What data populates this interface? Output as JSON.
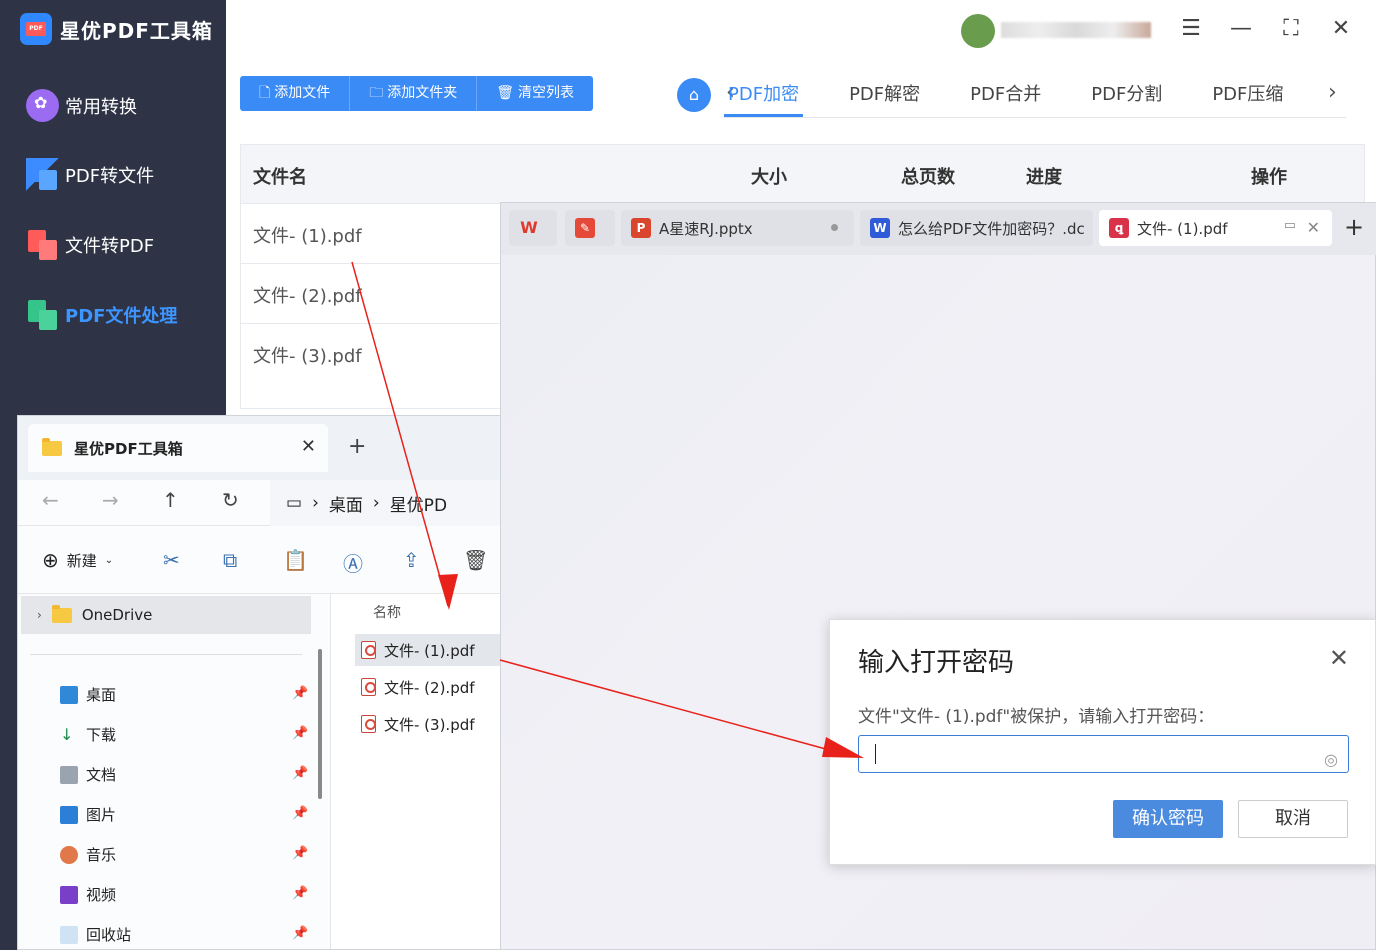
{
  "app": {
    "title": "星优PDF工具箱",
    "sidebar": [
      {
        "label": "常用转换",
        "icon": "common-convert-icon"
      },
      {
        "label": "PDF转文件",
        "icon": "pdf-to-file-icon"
      },
      {
        "label": "文件转PDF",
        "icon": "file-to-pdf-icon"
      },
      {
        "label": "PDF文件处理",
        "icon": "pdf-process-icon",
        "active": true
      }
    ],
    "toolbar": {
      "add_file": "添加文件",
      "add_folder": "添加文件夹",
      "clear_list": "清空列表"
    },
    "function_tabs": [
      "PDF加密",
      "PDF解密",
      "PDF合并",
      "PDF分割",
      "PDF压缩"
    ],
    "active_tab": "PDF加密",
    "table": {
      "headers": [
        "文件名",
        "大小",
        "总页数",
        "进度",
        "操作"
      ],
      "rows": [
        "文件- (1).pdf",
        "文件- (2).pdf",
        "文件- (3).pdf"
      ]
    }
  },
  "wps": {
    "tabs": [
      {
        "label": "",
        "icon": "wps-logo-icon"
      },
      {
        "label": "",
        "icon": "pdf-reader-icon"
      },
      {
        "label": "A星速RJ.pptx",
        "icon": "ppt-icon"
      },
      {
        "label": "怎么给PDF文件加密码？.dc",
        "icon": "word-icon"
      },
      {
        "label": "文件- (1).pdf",
        "icon": "pdf-icon",
        "active": true
      }
    ]
  },
  "explorer": {
    "tab_title": "星优PDF工具箱",
    "path": [
      "桌面",
      "星优PD"
    ],
    "new_label": "新建",
    "nav": {
      "onedrive": "OneDrive",
      "quick_access": [
        "桌面",
        "下载",
        "文档",
        "图片",
        "音乐",
        "视频",
        "回收站"
      ]
    },
    "files_header": "名称",
    "files": [
      "文件- (1).pdf",
      "文件- (2).pdf",
      "文件- (3).pdf"
    ]
  },
  "dialog": {
    "title": "输入打开密码",
    "message": "文件\"文件- (1).pdf\"被保护，请输入打开密码：",
    "confirm": "确认密码",
    "cancel": "取消"
  }
}
